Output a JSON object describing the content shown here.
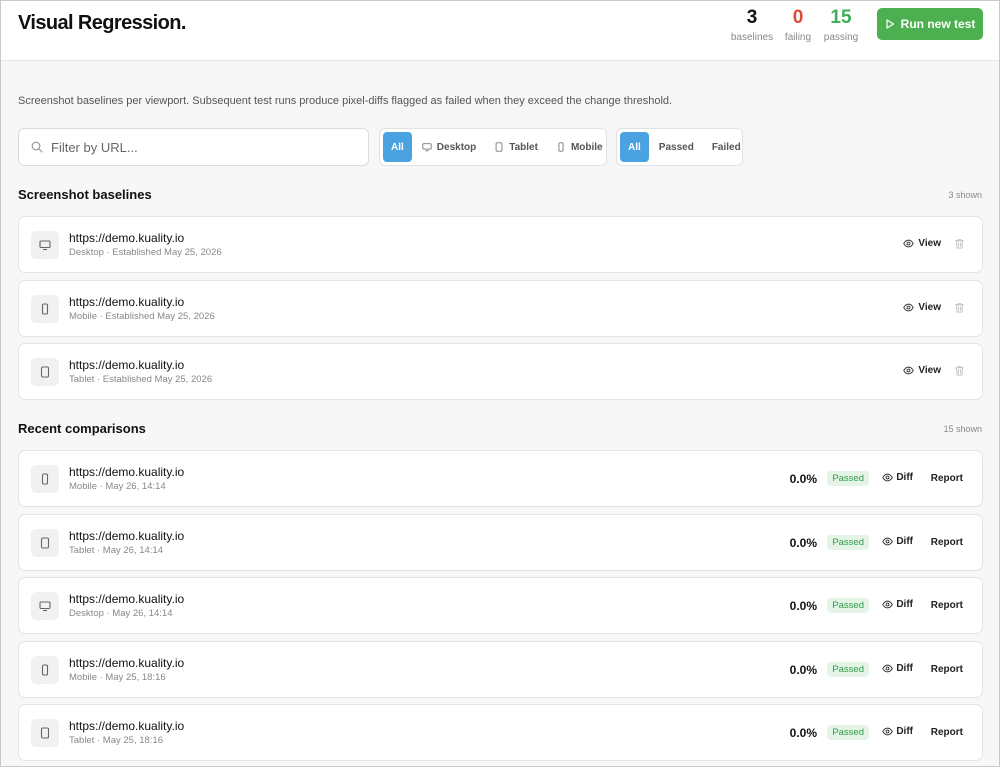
{
  "header": {
    "title": "Visual Regression.",
    "stats": {
      "baselines": {
        "value": "3",
        "label": "baselines"
      },
      "failing": {
        "value": "0",
        "label": "failing"
      },
      "passing": {
        "value": "15",
        "label": "passing"
      }
    },
    "run_button": "Run new test"
  },
  "description": "Screenshot baselines per viewport. Subsequent test runs produce pixel-diffs flagged as failed when they exceed the change threshold.",
  "filters": {
    "search_placeholder": "Filter by URL...",
    "viewport": [
      "All",
      "Desktop",
      "Tablet",
      "Mobile"
    ],
    "status": [
      "All",
      "Passed",
      "Failed"
    ]
  },
  "baselines_section": {
    "title": "Screenshot baselines",
    "count": "3 shown",
    "view_label": "View",
    "items": [
      {
        "url": "https://demo.kuality.io",
        "meta": "Desktop · Established May 25, 2026",
        "device": "desktop"
      },
      {
        "url": "https://demo.kuality.io",
        "meta": "Mobile · Established May 25, 2026",
        "device": "mobile"
      },
      {
        "url": "https://demo.kuality.io",
        "meta": "Tablet · Established May 25, 2026",
        "device": "tablet"
      }
    ]
  },
  "comparisons_section": {
    "title": "Recent comparisons",
    "count": "15 shown",
    "diff_label": "Diff",
    "report_label": "Report",
    "items": [
      {
        "url": "https://demo.kuality.io",
        "meta": "Mobile · May 26, 14:14",
        "device": "mobile",
        "pct": "0.0%",
        "status": "Passed"
      },
      {
        "url": "https://demo.kuality.io",
        "meta": "Tablet · May 26, 14:14",
        "device": "tablet",
        "pct": "0.0%",
        "status": "Passed"
      },
      {
        "url": "https://demo.kuality.io",
        "meta": "Desktop · May 26, 14:14",
        "device": "desktop",
        "pct": "0.0%",
        "status": "Passed"
      },
      {
        "url": "https://demo.kuality.io",
        "meta": "Mobile · May 25, 18:16",
        "device": "mobile",
        "pct": "0.0%",
        "status": "Passed"
      },
      {
        "url": "https://demo.kuality.io",
        "meta": "Tablet · May 25, 18:16",
        "device": "tablet",
        "pct": "0.0%",
        "status": "Passed"
      }
    ]
  },
  "colors": {
    "accent_blue": "#4aa3e0",
    "accent_green": "#4caf50",
    "failing_red": "#e04a3c",
    "passing_green": "#3fae54"
  }
}
